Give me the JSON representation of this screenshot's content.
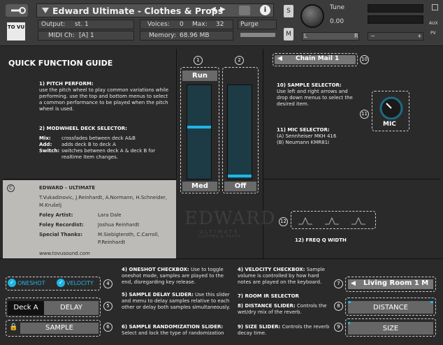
{
  "header": {
    "title": "Edward Ultimate - Clothes & Props",
    "logo_text": "TO VU",
    "output_label": "Output:",
    "output_value": "st. 1",
    "voices_label": "Voices:",
    "voices_value": "0",
    "max_label": "Max:",
    "max_value": "32",
    "purge_label": "Purge",
    "midi_label": "MIDI Ch:",
    "midi_value": "[A] 1",
    "memory_label": "Memory:",
    "memory_value": "68.96 MB",
    "s_label": "S",
    "m_label": "M",
    "tune_label": "Tune",
    "tune_value": "0.00",
    "l_label": "L",
    "r_label": "R",
    "aux_label": "AUX",
    "pv_label": "PV",
    "minus_label": "−",
    "plus_label": "+"
  },
  "guide": {
    "title": "QUICK FUNCTION GUIDE",
    "s1_title": "1) PITCH PERFORM:",
    "s1_text": "use the pitch wheel to play common variations while performing. use the top and bottom menus to select a common performance to be played when the pitch wheel is used.",
    "s2_title": "2) MODWHEEL DECK SELECTOR:",
    "mix_k": "Mix:",
    "mix_v": "crossfades between deck A&B",
    "add_k": "Add:",
    "add_v": "adds deck B to deck A",
    "switch_k": "Switch:",
    "switch_v": "switches between deck A & deck B for realtime item changes.",
    "s10_title": "10) SAMPLE SELECTOR:",
    "s10_text": "Use left and right arrows and drop down  menus to select the desired item.",
    "s11_title": "11) MIC SELECTOR:",
    "s11_a": "(A) Sennheiser MKH 416",
    "s11_b": "(B) Neumann KMR81i",
    "s12_title": "12) FREQ Q WIDTH",
    "s4_title": "4) ONESHOT CHECKBOX:",
    "s4_text": "Use to toggle oneshot mode, samples are played to the end, disregarding key release.",
    "s5_title": "5) SAMPLE DELAY SLIDER:",
    "s5_text": "Use this  slider and menu to delay samples relative to each other or delay both samples simultaneously.",
    "s6_title": "6) SAMPLE RANDOMIZATION SLIDER:",
    "s6_text": "Select and lock the type of randomization",
    "s40_title": "4) VELOCITY CHECKBOX:",
    "s40_text": "Sample volume is controlled by how hard notes are played on the keyboard.",
    "s7_title": "7) ROOM IR SELECTOR",
    "s8_title": "8) DISTANCE SLIDER:",
    "s8_text": "Controls the wet/dry mix of the reverb.",
    "s9_title": "9) SIZE SLIDER:",
    "s9_text": "Controls the reverb decay time."
  },
  "controls": {
    "run_label": "Run",
    "med_label": "Med",
    "off_label": "Off",
    "sample_menu": "Chain Mail 1",
    "mic_label": "MIC",
    "oneshot_label": "ONESHOT",
    "velocity_label": "VELOCITY",
    "deck_a_label": "Deck A",
    "delay_label": "DELAY",
    "sample_label": "SAMPLE",
    "room_menu": "Living Room 1 M",
    "distance_label": "DISTANCE",
    "size_label": "SIZE",
    "pitch_slider_level": 0.56,
    "mod_slider_level": 0.02
  },
  "numbers": [
    "1",
    "2",
    "4",
    "5",
    "6",
    "7",
    "8",
    "9",
    "10",
    "11",
    "12"
  ],
  "credits": {
    "c_mark": "C",
    "title": "EDWARD - ULTIMATE",
    "names": "T.Vukadinovic, J.Reinhardt, A.Normann, H.Schneider, M.Krušelj",
    "foley_artist_k": "Foley Artist:",
    "foley_artist_v": "Lara Dale",
    "foley_recordist_k": "Foley Recordist:",
    "foley_recordist_v": "Joshua Reinhardt",
    "thanks_k": "Special Thanks:",
    "thanks_v": "M.Siebigteroth, C.Carroll, P.Reinhardt",
    "website": "www.tovusound.com"
  },
  "watermark": {
    "line1": "EDWARD",
    "line2": "ULTIMATE",
    "line3": "CLOTHES & PROPS"
  },
  "colors": {
    "accent": "#1fb6e6",
    "panel": "#2a2a2a",
    "credits_bg": "#bdbbb8"
  }
}
